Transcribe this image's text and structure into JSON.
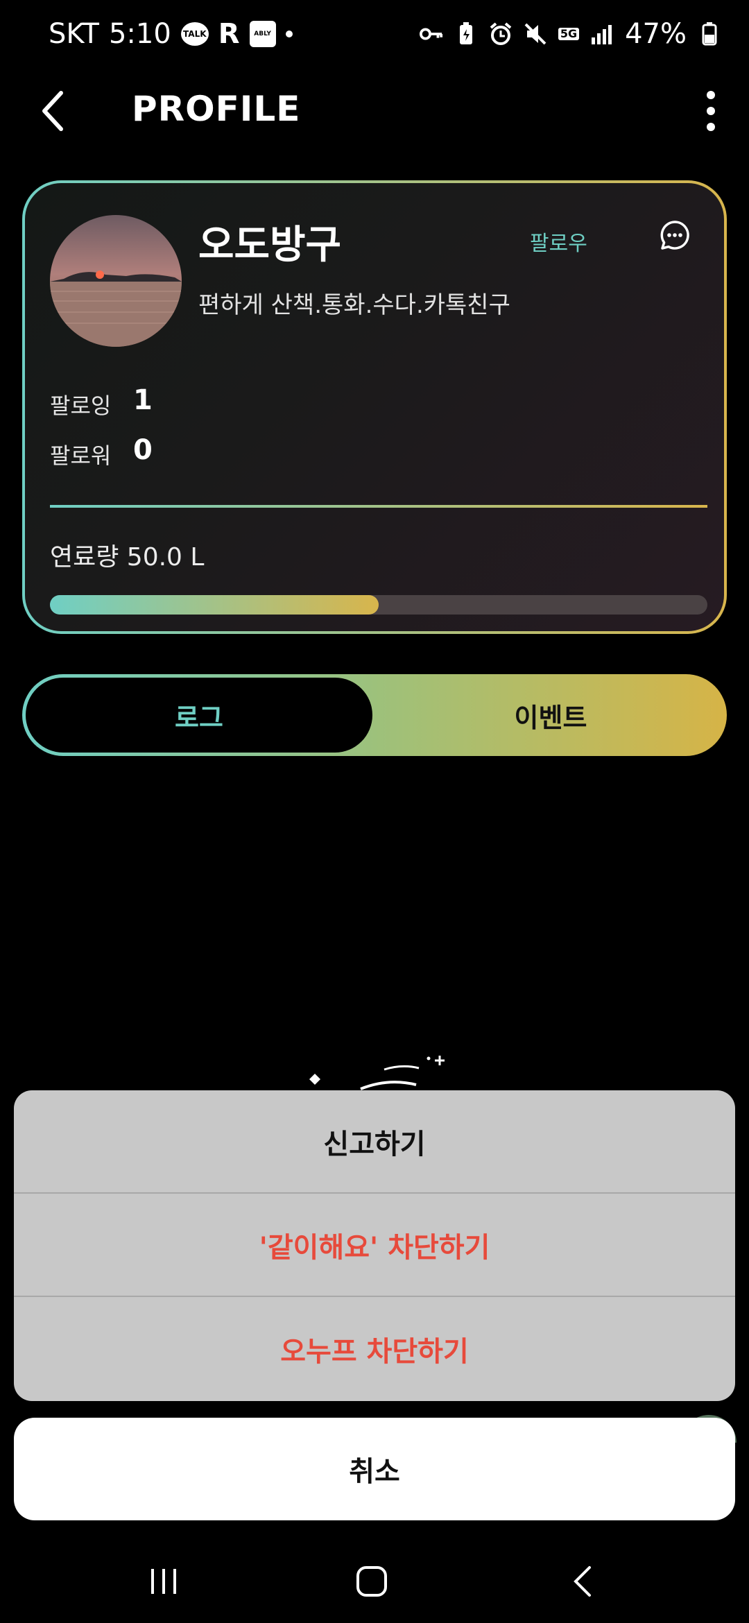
{
  "status_bar": {
    "carrier": "SKT",
    "time": "5:10",
    "talk_badge": "TALK",
    "r_badge": "R",
    "ably_badge": "ABLY",
    "network": "5G",
    "battery": "47%"
  },
  "header": {
    "title": "PROFILE"
  },
  "profile": {
    "name": "오도방구",
    "follow_label": "팔로우",
    "bio": "편하게 산책.통화.수다.카톡친구",
    "following_label": "팔로잉",
    "following_count": "1",
    "followers_label": "팔로워",
    "followers_count": "0",
    "fuel_label": "연료량 50.0 L",
    "fuel_fraction": 0.5
  },
  "tabs": {
    "log": "로그",
    "event": "이벤트"
  },
  "action_sheet": {
    "report": "신고하기",
    "block_together": "'같이해요' 차단하기",
    "block_onup": "오누프 차단하기",
    "cancel": "취소"
  },
  "colors": {
    "accent_teal": "#6fcfc4",
    "accent_gold": "#d8b54c",
    "danger": "#e74a3b"
  }
}
